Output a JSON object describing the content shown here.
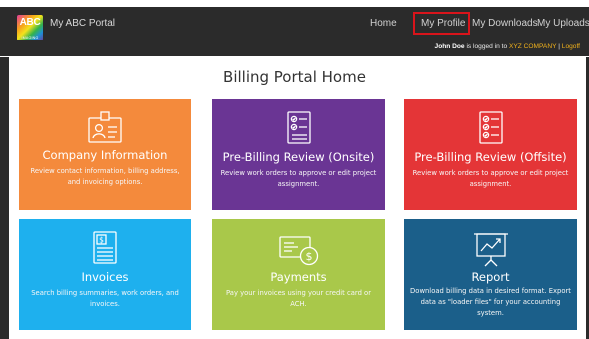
{
  "brand": {
    "logo_text": "ABC",
    "logo_subtext": "IMAGING",
    "title": "My ABC Portal"
  },
  "nav": {
    "home": "Home",
    "my_profile": "My Profile",
    "my_downloads": "My Downloads",
    "my_uploads": "My Uploads",
    "highlighted": "My Profile",
    "highlight_color": "#d9141b"
  },
  "userbar": {
    "user": "John Doe",
    "logged_in_text": "is logged in to",
    "company": "XYZ COMPANY",
    "separator": "|",
    "logoff": "Logoff"
  },
  "page": {
    "title": "Billing Portal Home"
  },
  "tiles": [
    {
      "title": "Company Information",
      "description": "Review contact information, billing address, and invoicing options.",
      "icon": "id-badge-icon",
      "color": "#f48a3c"
    },
    {
      "title": "Pre-Billing Review (Onsite)",
      "description": "Review work orders to approve or edit project assignment.",
      "icon": "checklist-icon",
      "color": "#6a3594"
    },
    {
      "title": "Pre-Billing Review (Offsite)",
      "description": "Review work orders to approve or edit project assignment.",
      "icon": "checklist-icon",
      "color": "#e43537"
    },
    {
      "title": "Invoices",
      "description": "Search billing summaries, work orders, and invoices.",
      "icon": "invoice-icon",
      "color": "#1eb0ee"
    },
    {
      "title": "Payments",
      "description": "Pay your invoices using your credit card or ACH.",
      "icon": "card-payment-icon",
      "color": "#a9c84a"
    },
    {
      "title": "Report",
      "description": "Download billing data in desired format. Export data as \"loader files\" for your accounting system.",
      "icon": "presentation-chart-icon",
      "color": "#1b5f8a"
    }
  ]
}
